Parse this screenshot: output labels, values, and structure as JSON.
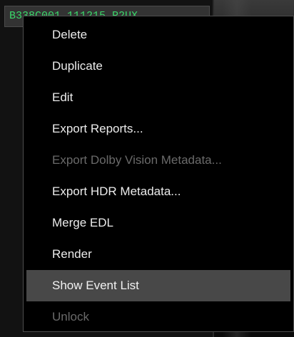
{
  "timeline": {
    "name": "B338C001_111215_R2UX"
  },
  "context_menu": {
    "items": [
      {
        "label": "Delete",
        "enabled": true,
        "highlighted": false
      },
      {
        "label": "Duplicate",
        "enabled": true,
        "highlighted": false
      },
      {
        "label": "Edit",
        "enabled": true,
        "highlighted": false
      },
      {
        "label": "Export Reports...",
        "enabled": true,
        "highlighted": false
      },
      {
        "label": "Export Dolby Vision Metadata...",
        "enabled": false,
        "highlighted": false
      },
      {
        "label": "Export HDR Metadata...",
        "enabled": true,
        "highlighted": false
      },
      {
        "label": "Merge EDL",
        "enabled": true,
        "highlighted": false
      },
      {
        "label": "Render",
        "enabled": true,
        "highlighted": false
      },
      {
        "label": "Show Event List",
        "enabled": true,
        "highlighted": true
      },
      {
        "label": "Unlock",
        "enabled": false,
        "highlighted": false
      }
    ]
  },
  "colors": {
    "timeline_text": "#3bd66a",
    "menu_background": "#000000",
    "menu_text": "#ececec",
    "menu_disabled_text": "#6a6a6a",
    "menu_highlight": "#484848"
  }
}
